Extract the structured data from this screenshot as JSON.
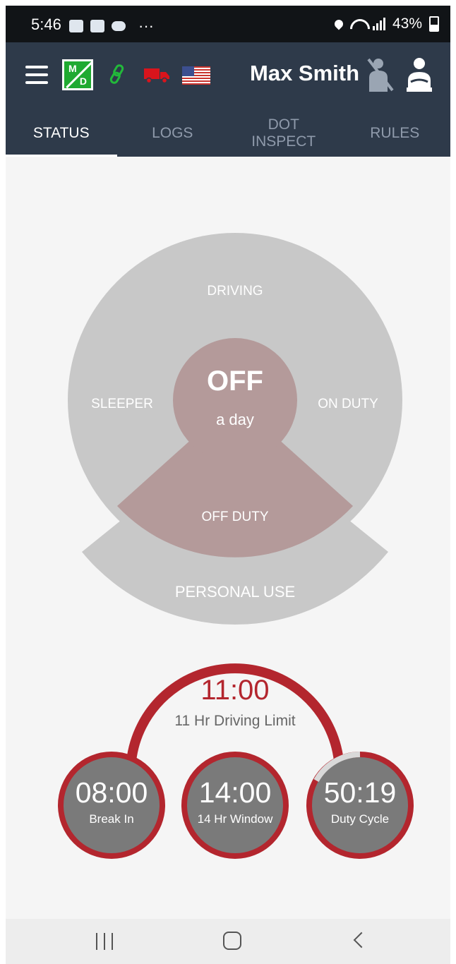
{
  "status_bar": {
    "time": "5:46",
    "more": "···",
    "battery": "43%"
  },
  "app_bar": {
    "logo_m": "M",
    "logo_d": "D",
    "driver_name": "Max Smith"
  },
  "tabs": [
    {
      "label": "STATUS",
      "active": true
    },
    {
      "label_line1": "DOT",
      "label_line2": "INSPECT"
    },
    {
      "label": "LOGS"
    },
    {
      "label": "RULES"
    }
  ],
  "status_wheel": {
    "center_status": "OFF",
    "center_sub": "a day",
    "segments": {
      "driving": "DRIVING",
      "sleeper": "SLEEPER",
      "on_duty": "ON DUTY",
      "off_duty": "OFF DUTY",
      "personal_use": "PERSONAL USE"
    },
    "colors": {
      "wheel": "#c8c8c8",
      "active": "#b49a9a"
    }
  },
  "timers": {
    "driving_limit": {
      "time": "11:00",
      "label": "11 Hr Driving Limit"
    },
    "break_in": {
      "time": "08:00",
      "label": "Break In"
    },
    "window": {
      "time": "14:00",
      "label": "14 Hr Window"
    },
    "duty_cycle": {
      "time": "50:19",
      "label": "Duty Cycle"
    },
    "colors": {
      "ring": "#b3262e",
      "dial": "#7a7a7a"
    }
  }
}
